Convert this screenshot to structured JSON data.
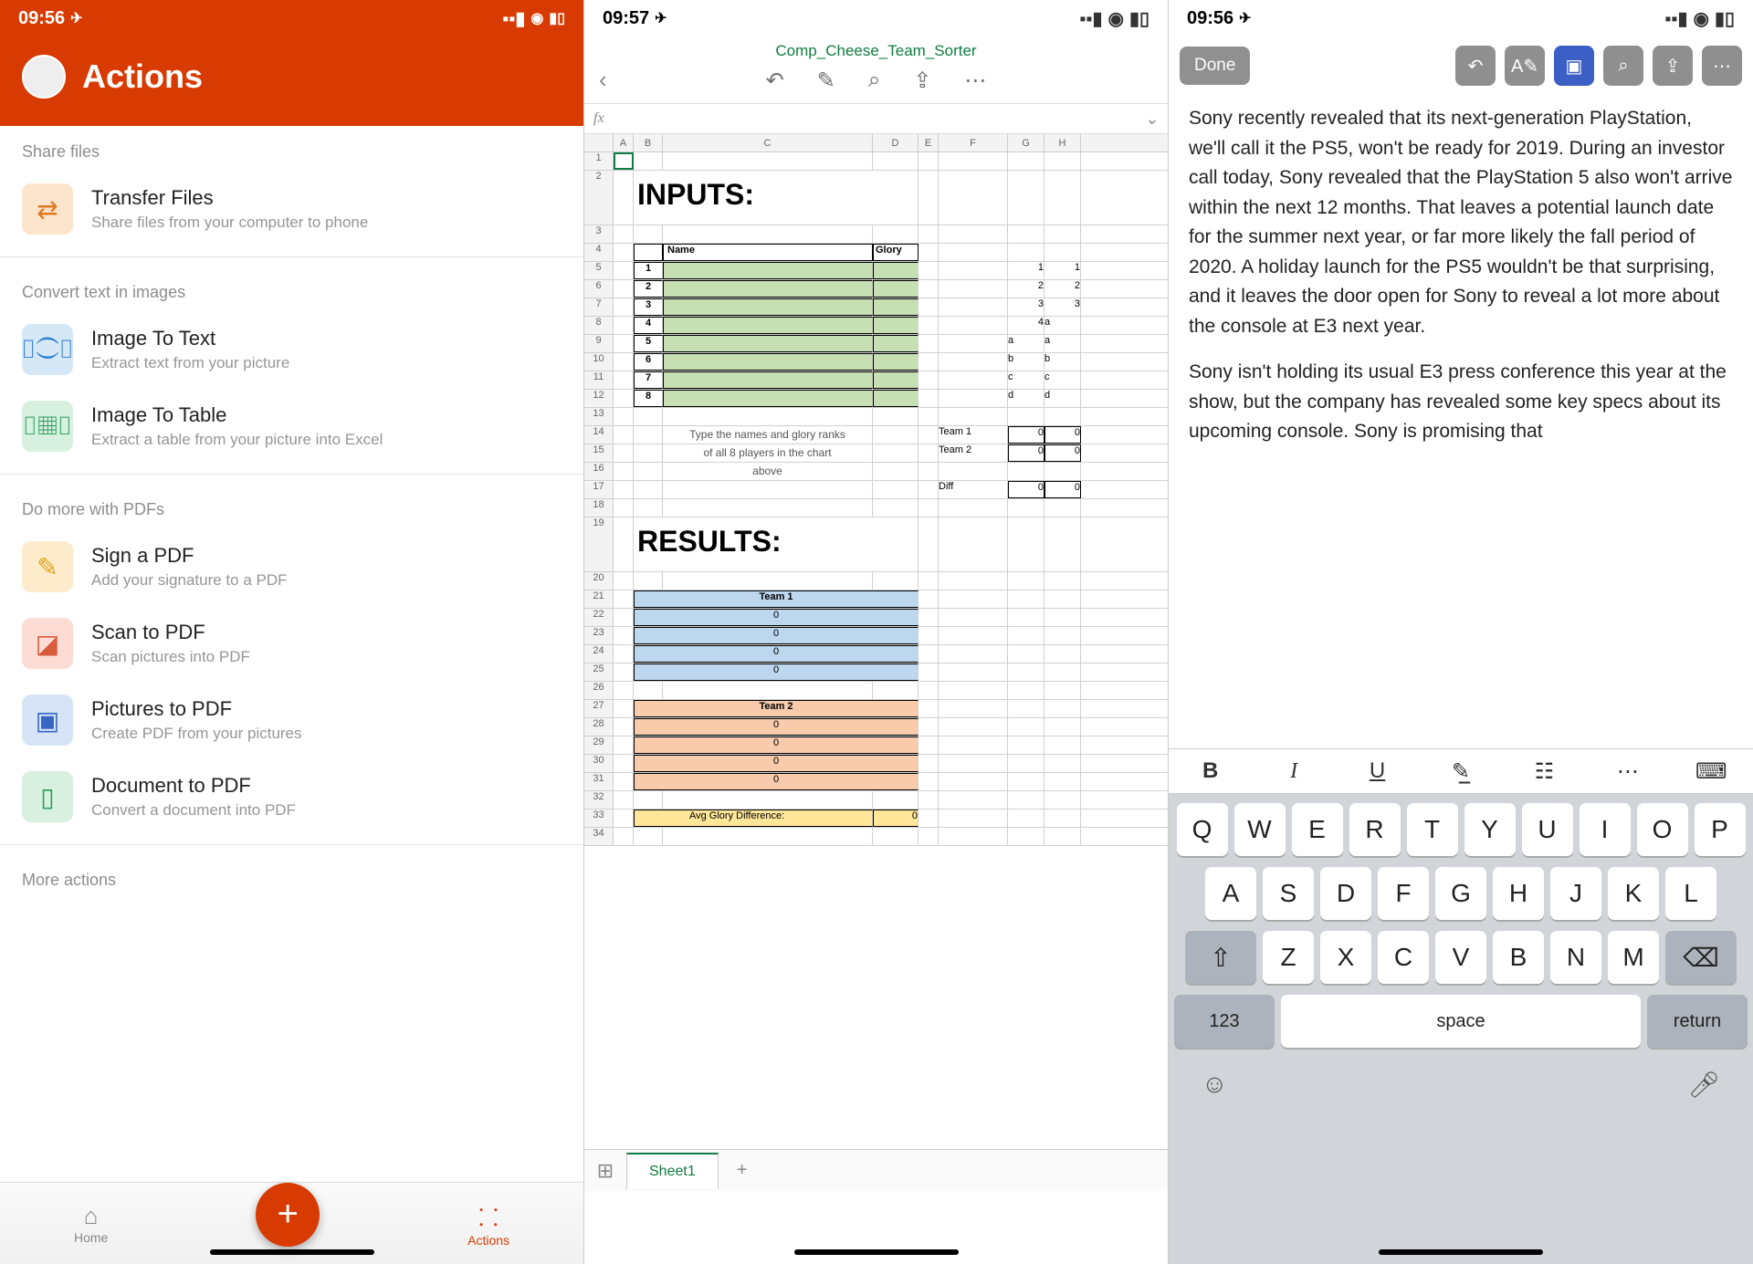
{
  "status": {
    "time1": "09:56",
    "time2": "09:57",
    "time3": "09:56",
    "loc": "◂"
  },
  "pane1": {
    "title": "Actions",
    "sections": {
      "share": "Share files",
      "convert": "Convert text in images",
      "pdf": "Do more with PDFs",
      "more": "More actions"
    },
    "items": {
      "transfer": {
        "t": "Transfer Files",
        "s": "Share files from your computer to phone"
      },
      "img2txt": {
        "t": "Image To Text",
        "s": "Extract text from your picture"
      },
      "img2tbl": {
        "t": "Image To Table",
        "s": "Extract a table from your picture into Excel"
      },
      "sign": {
        "t": "Sign a PDF",
        "s": "Add your signature to a PDF"
      },
      "scan": {
        "t": "Scan to PDF",
        "s": "Scan pictures into PDF"
      },
      "pics": {
        "t": "Pictures to PDF",
        "s": "Create PDF from your pictures"
      },
      "doc": {
        "t": "Document to PDF",
        "s": "Convert a document into PDF"
      }
    },
    "nav": {
      "home": "Home",
      "actions": "Actions"
    }
  },
  "pane2": {
    "filename": "Comp_Cheese_Team_Sorter",
    "fx": "fx",
    "cols": [
      "",
      "A",
      "B",
      "C",
      "D",
      "E",
      "F",
      "G",
      "H"
    ],
    "big1": "INPUTS:",
    "big2": "RESULTS:",
    "nameHdr": "Name",
    "gloryHdr": "Glory",
    "nums": [
      "1",
      "2",
      "3",
      "4",
      "5",
      "6",
      "7",
      "8"
    ],
    "sideNums": [
      [
        "1",
        "1"
      ],
      [
        "2",
        "2"
      ],
      [
        "3",
        "3"
      ],
      [
        "4",
        "a"
      ]
    ],
    "sideLetters": [
      [
        "a",
        "a"
      ],
      [
        "b",
        "b"
      ],
      [
        "c",
        "c"
      ],
      [
        "d",
        "d"
      ]
    ],
    "hint1": "Type the names and glory ranks",
    "hint2": "of all 8 players in the chart",
    "hint3": "above",
    "team1lbl": "Team 1",
    "team2lbl": "Team 2",
    "difflbl": "Diff",
    "zeros": [
      "0",
      "0",
      "0",
      "0"
    ],
    "team1": "Team 1",
    "team2": "Team 2",
    "avg": "Avg Glory Difference:",
    "avgval": "0",
    "sheet": "Sheet1",
    "zero": "0"
  },
  "pane3": {
    "done": "Done",
    "para1": "Sony recently revealed that its next-generation PlayStation, we'll call it the PS5, won't be ready for 2019. During an investor call today, Sony revealed that the PlayStation 5 also won't arrive within the next 12 months. That leaves a potential launch date for the summer next year, or far more likely the fall period of 2020. A holiday launch for the PS5 wouldn't be that surprising, and it leaves the door open for Sony to reveal a lot more about the console at E3 next year.",
    "para2": "Sony isn't holding its usual E3 press conference this year at the show, but the company has revealed some key specs about its upcoming console. Sony is promising that",
    "fmt": {
      "b": "B",
      "i": "I",
      "u": "U"
    },
    "kbd": {
      "r1": [
        "Q",
        "W",
        "E",
        "R",
        "T",
        "Y",
        "U",
        "I",
        "O",
        "P"
      ],
      "r2": [
        "A",
        "S",
        "D",
        "F",
        "G",
        "H",
        "J",
        "K",
        "L"
      ],
      "r3": [
        "Z",
        "X",
        "C",
        "V",
        "B",
        "N",
        "M"
      ],
      "num": "123",
      "space": "space",
      "return": "return"
    }
  }
}
